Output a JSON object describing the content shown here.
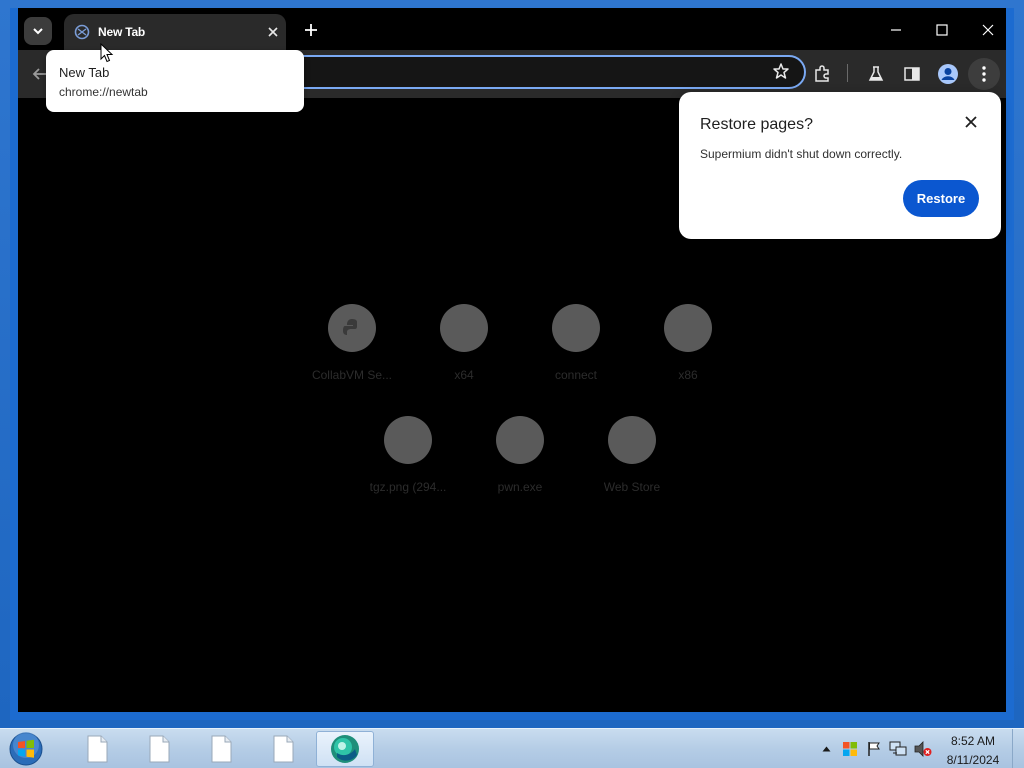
{
  "browser": {
    "tab": {
      "title": "New Tab",
      "favicon": "supermium-icon"
    },
    "hover_card": {
      "title": "New Tab",
      "url": "chrome://newtab"
    },
    "window_controls": [
      "minimize-icon",
      "maximize-icon",
      "close-icon"
    ],
    "toolbar_icons": [
      "back-icon",
      "bookmark-star-icon",
      "extensions-icon",
      "labs-flask-icon",
      "side-panel-icon",
      "profile-icon",
      "more-menu-icon"
    ]
  },
  "restore_bubble": {
    "title": "Restore pages?",
    "message": "Supermium didn't shut down correctly.",
    "button_label": "Restore"
  },
  "shortcuts": [
    {
      "label": "CollabVM Se...",
      "icon": "collabvm-icon"
    },
    {
      "label": "x64",
      "icon": "generic-site-icon"
    },
    {
      "label": "connect",
      "icon": "generic-site-icon"
    },
    {
      "label": "x86",
      "icon": "generic-site-icon"
    },
    {
      "label": "tgz.png (294...",
      "icon": "generic-site-icon"
    },
    {
      "label": "pwn.exe",
      "icon": "generic-site-icon"
    },
    {
      "label": "Web Store",
      "icon": "generic-site-icon"
    }
  ],
  "taskbar": {
    "items": [
      "file-icon",
      "file-icon",
      "file-icon",
      "file-icon",
      "supermium-icon"
    ],
    "tray_icons": [
      "show-hidden-icons-icon",
      "windows-flag-icon",
      "action-center-flag-icon",
      "network-icon",
      "volume-muted-icon"
    ],
    "clock": {
      "time": "8:52 AM",
      "date": "8/11/2024"
    }
  },
  "colors": {
    "accent": "#0b57d0",
    "window_border": "#1c6bd0",
    "tile_circle": "#5a5a5a"
  }
}
